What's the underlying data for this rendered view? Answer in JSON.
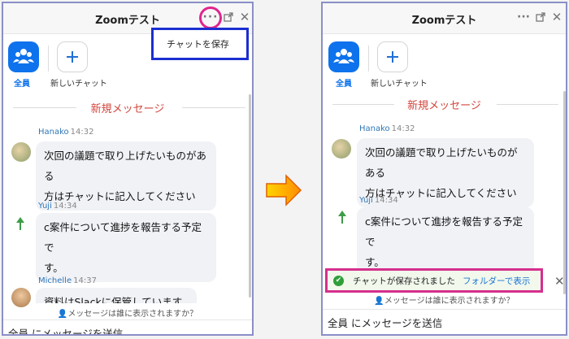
{
  "window": {
    "title": "Zoomテスト"
  },
  "toolbar": {
    "everyone_label": "全員",
    "new_chat_label": "新しいチャット"
  },
  "chat": {
    "new_messages_label": "新規メッセージ",
    "messages": [
      {
        "sender": "Hanako",
        "time": "14:32",
        "line1": "次回の議題で取り上げたいものがある",
        "line2": "方はチャットに記入してください"
      },
      {
        "sender": "Yuji",
        "time": "14:34",
        "line1": "c案件について進捗を報告する予定で",
        "line2": "す。"
      },
      {
        "sender": "Michelle",
        "time": "14:37",
        "line1": "資料はSlackに保管しています"
      }
    ]
  },
  "footer": {
    "visibility_note": "メッセージは誰に表示されますか？",
    "composer_placeholder": "全員 にメッセージを送信"
  },
  "menu": {
    "save_chat": "チャットを保存"
  },
  "toast": {
    "message": "チャットが保存されました",
    "link": "フォルダーで表示"
  },
  "icons": {
    "more": "more-dots-icon",
    "popout": "popout-icon",
    "close": "close-icon",
    "arrow": "arrow-right-icon"
  }
}
